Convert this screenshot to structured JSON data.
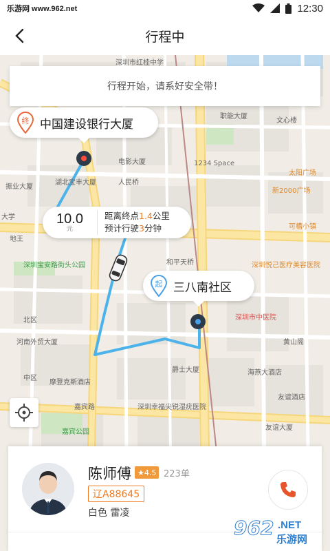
{
  "status_bar": {
    "source": "乐游网 www.962.net",
    "time": "12:30"
  },
  "header": {
    "title": "行程中"
  },
  "toast": {
    "message": "行程开始，请系好安全带！"
  },
  "destination": {
    "marker": "终",
    "name": "中国建设银行大厦"
  },
  "origin": {
    "marker": "起",
    "name": "三八南社区"
  },
  "trip_info": {
    "fare": "10.0",
    "fare_unit": "元",
    "distance_prefix": "距离终点",
    "distance_value": "1.4",
    "distance_unit": "公里",
    "eta_prefix": "预计行驶",
    "eta_value": "3",
    "eta_unit": "分钟"
  },
  "map_labels": {
    "l1": "深圳市红桂中学",
    "l2": "职能大厦",
    "l3": "文心楼",
    "l4": "电影大厦",
    "l5": "1234 Space",
    "l6": "太阳广场",
    "l7": "振业大厦",
    "l8": "湖北宝丰大厦",
    "l9": "人民桥",
    "l10": "新2000广场",
    "l11": "深圳宝安路街头公园",
    "l12": "和平天桥",
    "l13": "可槽小镇",
    "l14": "深圳悦己医疗美容医院",
    "l15": "北区",
    "l16": "深圳市中医院",
    "l17": "河南外贸大厦",
    "l18": "爵士大厦",
    "l19": "海燕大酒店",
    "l20": "黄山阁",
    "l21": "中区",
    "l22": "摩登克斯酒店",
    "l23": "深圳幸福尖锐湿疣医院",
    "l24": "友谊酒店",
    "l25": "嘉宾路",
    "l26": "嘉宾公园",
    "l27": "友谊大厦",
    "l28": "地王",
    "l29": "大学"
  },
  "driver": {
    "name": "陈师傅",
    "rating": "★4.5",
    "orders": "223单",
    "plate": "辽A88645",
    "car": "白色 雷凌"
  },
  "watermark": {
    "num": "962",
    "net": ".NET",
    "site": "乐游网"
  },
  "colors": {
    "route": "#4cb3ea",
    "accent": "#f07b21",
    "pin_dest": "#e8683b",
    "pin_origin": "#4aa0e6"
  },
  "icons": {
    "back": "chevron-left-icon",
    "locate": "crosshair-icon",
    "call": "phone-icon",
    "car": "car-icon"
  }
}
